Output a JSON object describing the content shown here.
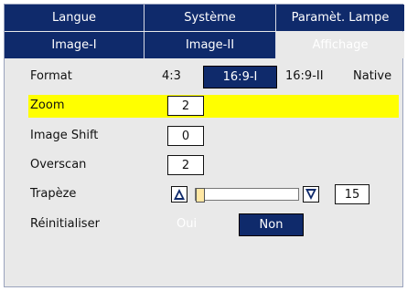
{
  "tabs_row1": [
    {
      "label": "Langue"
    },
    {
      "label": "Système"
    },
    {
      "label": "Paramèt. Lampe"
    }
  ],
  "tabs_row2": [
    {
      "label": "Image-I"
    },
    {
      "label": "Image-II"
    },
    {
      "label": "Affichage",
      "active": true
    }
  ],
  "rows": {
    "format": {
      "label": "Format",
      "options": [
        "4:3",
        "16:9-I",
        "16:9-II",
        "Native"
      ],
      "selected": "16:9-I"
    },
    "zoom": {
      "label": "Zoom",
      "value": "2"
    },
    "image_shift": {
      "label": "Image Shift",
      "value": "0"
    },
    "overscan": {
      "label": "Overscan",
      "value": "2"
    },
    "trapeze": {
      "label": "Trapèze",
      "value": "15",
      "slider_fraction": 0.0
    },
    "reset": {
      "label": "Réinitialiser",
      "options": [
        "Oui",
        "Non"
      ],
      "selected": "Non"
    }
  },
  "colors": {
    "tab_bg": "#0f2a6b",
    "panel_bg": "#e9e9e9",
    "highlight": "#ffff00",
    "selected_bg": "#0f2a6b"
  },
  "icons": [
    "keystone-minus-icon",
    "keystone-plus-icon"
  ]
}
